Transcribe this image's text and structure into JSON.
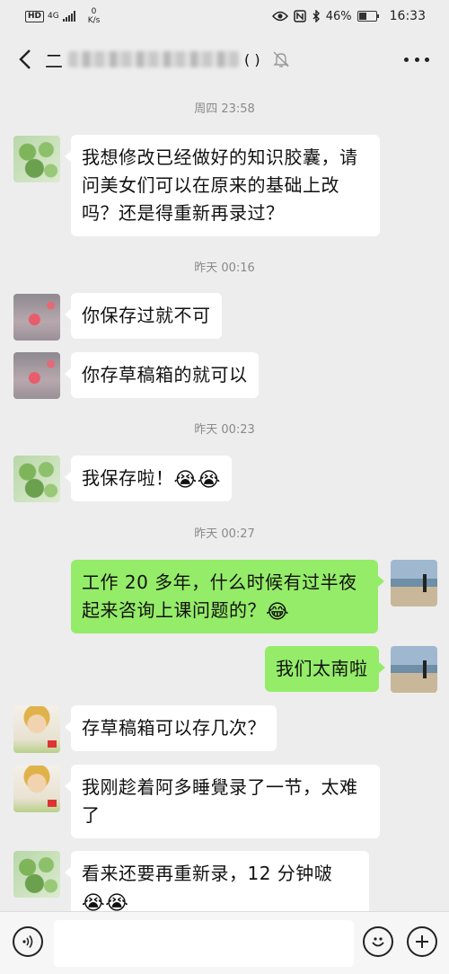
{
  "status_bar": {
    "hd": "HD",
    "network": "4G",
    "speed_value": "0",
    "speed_unit": "K/s",
    "battery_percent": "46%",
    "battery_level": 0.46,
    "time": "16:33"
  },
  "nav": {
    "title_prefix": "二",
    "title_suffix": "( )"
  },
  "messages": [
    {
      "type": "time",
      "text": "周四 23:58"
    },
    {
      "type": "msg",
      "side": "left",
      "avatar": "lotus",
      "text": "我想修改已经做好的知识胶囊，请问美女们可以在原来的基础上改吗？还是得重新再录过？"
    },
    {
      "type": "time",
      "text": "昨天 00:16"
    },
    {
      "type": "msg",
      "side": "left",
      "avatar": "flower",
      "text": "你保存过就不可"
    },
    {
      "type": "msg",
      "side": "left",
      "avatar": "flower",
      "text": "你存草稿箱的就可以"
    },
    {
      "type": "time",
      "text": "昨天 00:23"
    },
    {
      "type": "msg",
      "side": "left",
      "avatar": "lotus",
      "text": "我保存啦！",
      "emoji": "😭😭"
    },
    {
      "type": "time",
      "text": "昨天 00:27"
    },
    {
      "type": "msg",
      "side": "right",
      "avatar": "sea",
      "text": "工作 20 多年，什么时候有过半夜起来咨询上课问题的？",
      "emoji": "😂"
    },
    {
      "type": "msg",
      "side": "right",
      "avatar": "sea",
      "text": "我们太南啦"
    },
    {
      "type": "msg",
      "side": "left",
      "avatar": "cartoon",
      "text": "存草稿箱可以存几次？"
    },
    {
      "type": "msg",
      "side": "left",
      "avatar": "cartoon",
      "text": "我刚趁着阿多睡覺录了一节，太难了"
    },
    {
      "type": "msg",
      "side": "left",
      "avatar": "lotus",
      "text": "看来还要再重新录，12 分钟啵",
      "emoji": "😭😭"
    }
  ],
  "icons": {
    "back": "back-arrow-icon",
    "mute": "mute-bell-icon",
    "more": "more-dots-icon",
    "voice": "voice-icon",
    "emoji": "emoji-icon",
    "plus": "plus-icon"
  }
}
